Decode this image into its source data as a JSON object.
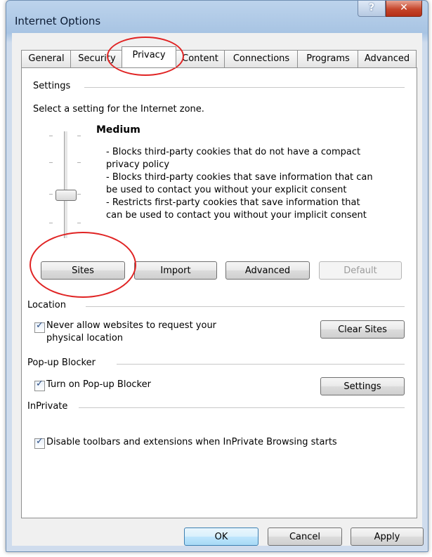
{
  "window": {
    "title": "Internet Options",
    "help_glyph": "?",
    "close_glyph": "✕"
  },
  "tabs": [
    "General",
    "Security",
    "Privacy",
    "Content",
    "Connections",
    "Programs",
    "Advanced"
  ],
  "active_tab": "Privacy",
  "settings": {
    "group_label": "Settings",
    "prompt": "Select a setting for the Internet zone.",
    "level": "Medium",
    "description_lines": [
      "- Blocks third-party cookies that do not have a compact",
      "privacy policy",
      "- Blocks third-party cookies that save information that can",
      "be used to contact you without your explicit consent",
      "- Restricts first-party cookies that save information that",
      "can be used to contact you without your implicit consent"
    ],
    "buttons": {
      "sites": "Sites",
      "import": "Import",
      "advanced": "Advanced",
      "default": "Default"
    }
  },
  "location": {
    "group_label": "Location",
    "checkbox_line1": "Never allow websites to request your",
    "checkbox_line2": "physical location",
    "checked": true,
    "clear_sites": "Clear Sites"
  },
  "popup": {
    "group_label": "Pop-up Blocker",
    "checkbox": "Turn on Pop-up Blocker",
    "checked": true,
    "settings": "Settings"
  },
  "inprivate": {
    "group_label": "InPrivate",
    "checkbox": "Disable toolbars and extensions when InPrivate Browsing starts",
    "checked": true
  },
  "footer": {
    "ok": "OK",
    "cancel": "Cancel",
    "apply": "Apply"
  },
  "colors": {
    "annotation": "#e02323",
    "title_bar": "#a8c4e3",
    "close_button": "#c5452b"
  },
  "check_glyph": "✓"
}
